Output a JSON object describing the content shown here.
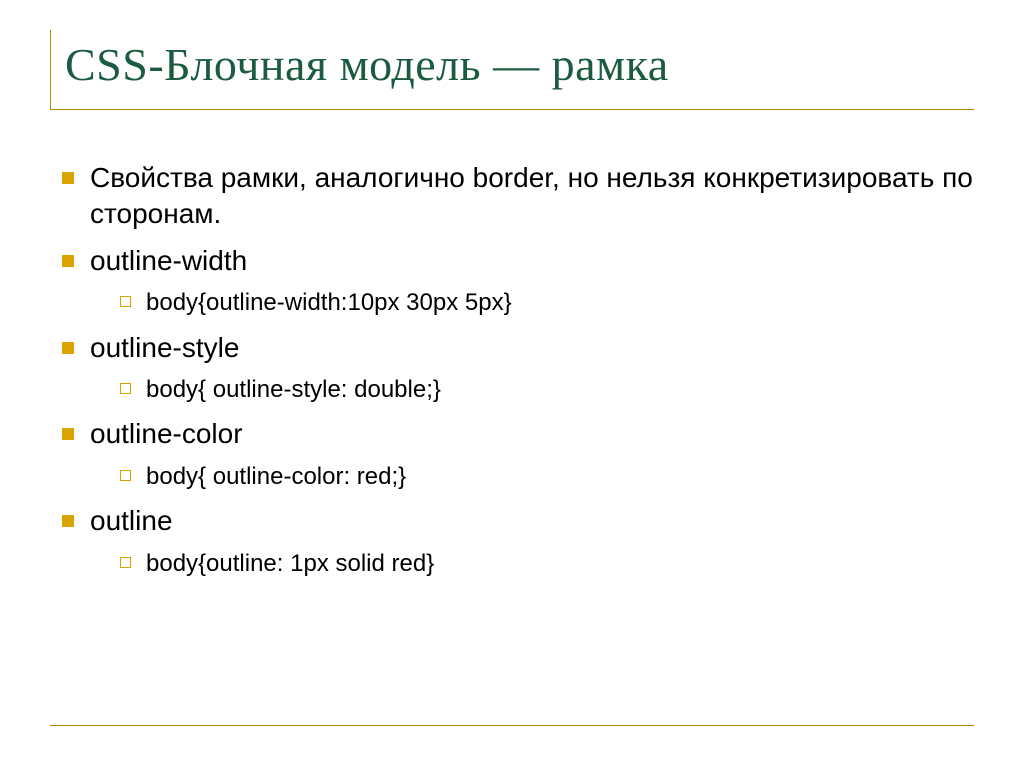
{
  "title": "CSS-Блочная модель — рамка",
  "bullets": {
    "b0": "Свойства рамки, аналогично border, но нельзя конкретизировать по сторонам.",
    "b1": "outline-width",
    "b1s0": "body{outline-width:10px 30px 5px}",
    "b2": "outline-style",
    "b2s0": "body{ outline-style: double;}",
    "b3": "outline-color",
    "b3s0": "body{ outline-color: red;}",
    "b4": "outline",
    "b4s0": "body{outline: 1px solid red}"
  }
}
